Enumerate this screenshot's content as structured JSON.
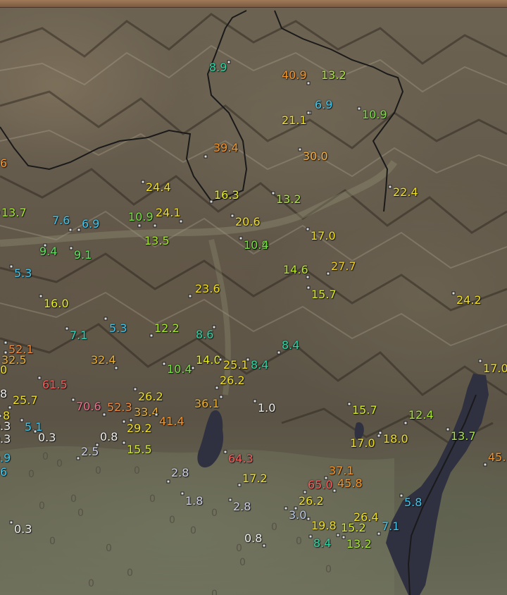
{
  "map": {
    "colors": {
      "lake": "#2f3140",
      "border": "#1a1a1a",
      "terrain": "#62584a",
      "topbar": "#a07a58"
    },
    "precip_labels": [
      {
        "v": "8.9",
        "c": "#2ad6a6"
      },
      {
        "v": "40.9",
        "c": "#f5962a"
      },
      {
        "v": "13.2",
        "c": "#a8e830"
      },
      {
        "v": "6.9",
        "c": "#3cc8f0"
      },
      {
        "v": "21.1",
        "c": "#f0e020"
      },
      {
        "v": "10.9",
        "c": "#78e040"
      },
      {
        "v": "39.4",
        "c": "#f5962a"
      },
      {
        "v": "30.0",
        "c": "#f5b040"
      },
      {
        "v": "24.4",
        "c": "#f0e020"
      },
      {
        "v": "16.3",
        "c": "#e8f020"
      },
      {
        "v": "13.2",
        "c": "#a8e830"
      },
      {
        "v": "22.4",
        "c": "#f0e020"
      },
      {
        "v": "6",
        "c": "#f5962a"
      },
      {
        "v": "13.7",
        "c": "#a8e830"
      },
      {
        "v": "7.6",
        "c": "#3cc8f0"
      },
      {
        "v": "6.9",
        "c": "#3cc8f0"
      },
      {
        "v": "10.9",
        "c": "#78e040"
      },
      {
        "v": "24.1",
        "c": "#f0e020"
      },
      {
        "v": "20.6",
        "c": "#f0e020"
      },
      {
        "v": "10.9",
        "c": "#78e040"
      },
      {
        "v": "17.0",
        "c": "#f0e020"
      },
      {
        "v": "13.5",
        "c": "#a8e830"
      },
      {
        "v": "10.4",
        "c": "#78e040"
      },
      {
        "v": "9.4",
        "c": "#60e060"
      },
      {
        "v": "9.1",
        "c": "#60e060"
      },
      {
        "v": "14.6",
        "c": "#b8e828"
      },
      {
        "v": "27.7",
        "c": "#f0d020"
      },
      {
        "v": "5.3",
        "c": "#3cc8f0"
      },
      {
        "v": "15.7",
        "c": "#d8ec20"
      },
      {
        "v": "23.6",
        "c": "#f0e020"
      },
      {
        "v": "24.2",
        "c": "#f0e020"
      },
      {
        "v": "16.0",
        "c": "#e8f020"
      },
      {
        "v": "7.1",
        "c": "#2ad6c0"
      },
      {
        "v": "5.3",
        "c": "#3cc8f0"
      },
      {
        "v": "12.2",
        "c": "#a8e830"
      },
      {
        "v": "8.6",
        "c": "#2ad6a6"
      },
      {
        "v": "8.4",
        "c": "#2ad6a6"
      },
      {
        "v": "52.1",
        "c": "#f08a3a"
      },
      {
        "v": "32.5",
        "c": "#f0b030"
      },
      {
        "v": "32.4",
        "c": "#f0b030"
      },
      {
        "v": "14.0",
        "c": "#e8f020"
      },
      {
        "v": "25.1",
        "c": "#f0e020"
      },
      {
        "v": "8.4",
        "c": "#2ad6a6"
      },
      {
        "v": "10.4",
        "c": "#78e040"
      },
      {
        "v": "17.0",
        "c": "#f0e020"
      },
      {
        "v": "0",
        "c": "#f0e020"
      },
      {
        "v": "26.2",
        "c": "#f0e020"
      },
      {
        "v": "61.5",
        "c": "#f06060"
      },
      {
        "v": "8",
        "c": "#eeeeee"
      },
      {
        "v": "26.2",
        "c": "#f0e020"
      },
      {
        "v": "25.7",
        "c": "#f0e020"
      },
      {
        "v": "70.6",
        "c": "#f07090"
      },
      {
        "v": "52.3",
        "c": "#f08a3a"
      },
      {
        "v": "36.1",
        "c": "#f0b030"
      },
      {
        "v": "1.0",
        "c": "#eeeeee"
      },
      {
        "v": "15.7",
        "c": "#d8ec20"
      },
      {
        "v": "33.4",
        "c": "#f0b030"
      },
      {
        "v": "8",
        "c": "#f0e020"
      },
      {
        "v": "41.4",
        "c": "#f5962a"
      },
      {
        "v": "12.4",
        "c": "#a8e830"
      },
      {
        "v": ".3",
        "c": "#eeeeee"
      },
      {
        "v": "5.1",
        "c": "#3cc8f0"
      },
      {
        "v": "29.2",
        "c": "#f0e020"
      },
      {
        "v": "18.0",
        "c": "#f0e020"
      },
      {
        "v": "0.3",
        "c": "#eeeeee"
      },
      {
        "v": "0.8",
        "c": "#eeeeee"
      },
      {
        "v": "17.0",
        "c": "#f0e020"
      },
      {
        "v": "13.7",
        "c": "#a8e830"
      },
      {
        "v": ".3",
        "c": "#eeeeee"
      },
      {
        "v": "2.5",
        "c": "#cfcfe8"
      },
      {
        "v": "15.5",
        "c": "#d8ec20"
      },
      {
        "v": "64.3",
        "c": "#f06060"
      },
      {
        "v": "45.",
        "c": "#f5962a"
      },
      {
        "v": ".9",
        "c": "#3cc8f0"
      },
      {
        "v": "2.8",
        "c": "#cfcfe8"
      },
      {
        "v": "37.1",
        "c": "#f5962a"
      },
      {
        "v": "17.2",
        "c": "#f0e020"
      },
      {
        "v": "65.0",
        "c": "#f06060"
      },
      {
        "v": "45.8",
        "c": "#f5962a"
      },
      {
        "v": "1.8",
        "c": "#cfcfe8"
      },
      {
        "v": "2.8",
        "c": "#cfcfe8"
      },
      {
        "v": "26.2",
        "c": "#f0e020"
      },
      {
        "v": "5.8",
        "c": "#3cc8f0"
      },
      {
        "v": "3.0",
        "c": "#b8c8f0"
      },
      {
        "v": "26.4",
        "c": "#f0e020"
      },
      {
        "v": "0.3",
        "c": "#eeeeee"
      },
      {
        "v": "19.8",
        "c": "#f0e020"
      },
      {
        "v": "15.2",
        "c": "#d8ec20"
      },
      {
        "v": "7.1",
        "c": "#3cc8f0"
      },
      {
        "v": "0.8",
        "c": "#eeeeee"
      },
      {
        "v": "8.4",
        "c": "#2ad6a6"
      },
      {
        "v": "13.2",
        "c": "#a8e830"
      },
      {
        "v": "6",
        "c": "#3cc8f0"
      }
    ],
    "zero_marks": [
      "0",
      "0",
      "0",
      "0",
      "0",
      "0",
      "0",
      "0",
      "0",
      "0",
      "0",
      "0",
      "0",
      "0",
      "0",
      "0",
      "0",
      "0",
      "0",
      "0",
      "0",
      "0"
    ]
  }
}
